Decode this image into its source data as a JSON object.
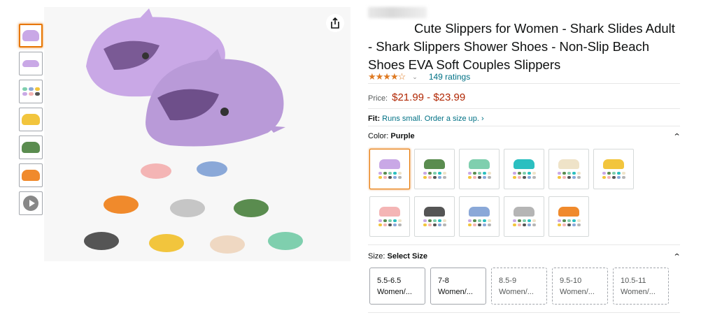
{
  "product": {
    "title": "Cute Slippers for Women - Shark Slides Adult - Shark Slippers Shower Shoes - Non-Slip Beach Shoes EVA Soft Couples Slippers",
    "rating_count_text": "149 ratings",
    "stars_display": "★★★★☆",
    "price_label": "Price:",
    "price": "$21.99 - $23.99",
    "fit_label": "Fit:",
    "fit_text": "Runs small. Order a size up. ›"
  },
  "color": {
    "label": "Color:",
    "selected": "Purple",
    "swatches": [
      {
        "name": "Purple",
        "hex": "#c9a8e6"
      },
      {
        "name": "Green",
        "hex": "#5a8c4f"
      },
      {
        "name": "Mint",
        "hex": "#7fcfae"
      },
      {
        "name": "Teal",
        "hex": "#2bbfc0"
      },
      {
        "name": "Beige",
        "hex": "#efe3c8"
      },
      {
        "name": "Yellow",
        "hex": "#f2c53d"
      },
      {
        "name": "Pink",
        "hex": "#f4b5b5"
      },
      {
        "name": "Black",
        "hex": "#555555"
      },
      {
        "name": "Blue",
        "hex": "#8aa8d8"
      },
      {
        "name": "Grey",
        "hex": "#b5b5b5"
      },
      {
        "name": "Orange",
        "hex": "#f08a2c"
      }
    ]
  },
  "size": {
    "label": "Size:",
    "selected": "Select Size",
    "options": [
      {
        "line1": "5.5-6.5",
        "line2": "Women/..."
      },
      {
        "line1": "7-8",
        "line2": "Women/..."
      },
      {
        "line1": "8.5-9",
        "line2": "Women/..."
      },
      {
        "line1": "9.5-10",
        "line2": "Women/..."
      },
      {
        "line1": "10.5-11",
        "line2": "Women/..."
      }
    ]
  },
  "colors": {
    "accent": "#e77600",
    "price": "#b12704",
    "link": "#007185",
    "star": "#de7921"
  },
  "icons": {
    "share": "share-icon",
    "play": "play-icon",
    "section_toggle": "chevron-up-icon",
    "rating_dropdown": "chevron-down-icon"
  }
}
